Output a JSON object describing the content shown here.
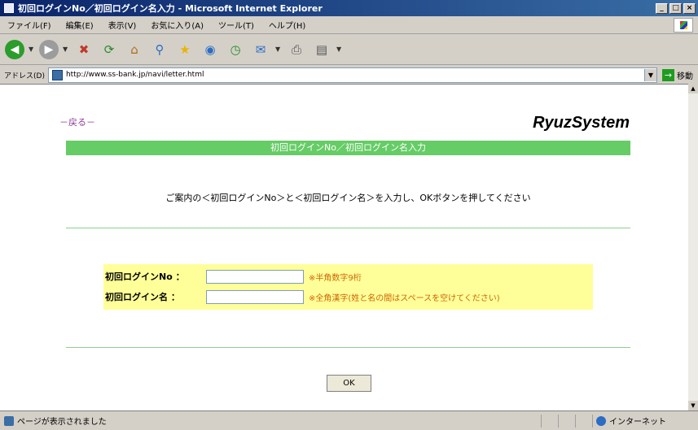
{
  "window": {
    "title": "初回ログインNo／初回ログイン名入力 - Microsoft Internet Explorer",
    "controls": {
      "minimize": "_",
      "maximize": "□",
      "close": "×"
    }
  },
  "menubar": {
    "items": [
      "ファイル(F)",
      "編集(E)",
      "表示(V)",
      "お気に入り(A)",
      "ツール(T)",
      "ヘルプ(H)"
    ]
  },
  "toolbar": {
    "icons": [
      "back-icon",
      "forward-icon",
      "stop-icon",
      "refresh-icon",
      "home-icon",
      "search-icon",
      "favorites-icon",
      "media-icon",
      "history-icon",
      "mail-icon",
      "print-icon",
      "edit-icon"
    ]
  },
  "address": {
    "label": "アドレス(D)",
    "url": "http://www.ss-bank.jp/navi/letter.html",
    "go_label": "移動"
  },
  "page": {
    "back_link": "－戻る－",
    "brand": "RyuzSystem",
    "banner": "初回ログインNo／初回ログイン名入力",
    "instructions": "ご案内の＜初回ログインNo＞と＜初回ログイン名＞を入力し、OKボタンを押してください",
    "form": {
      "login_no_label": "初回ログインNo ：",
      "login_no_value": "",
      "login_no_hint": "※半角数字9桁",
      "login_name_label": "初回ログイン名 ：",
      "login_name_value": "",
      "login_name_hint": "※全角漢字(姓と名の間はスペースを空けてください)"
    },
    "ok_button": "OK"
  },
  "status": {
    "text": "ページが表示されました",
    "zone": "インターネット"
  },
  "colors": {
    "banner": "#66cc66",
    "form_background": "#ffff99",
    "back_link": "#8e3e9a",
    "titlebar": "#0a246a"
  }
}
